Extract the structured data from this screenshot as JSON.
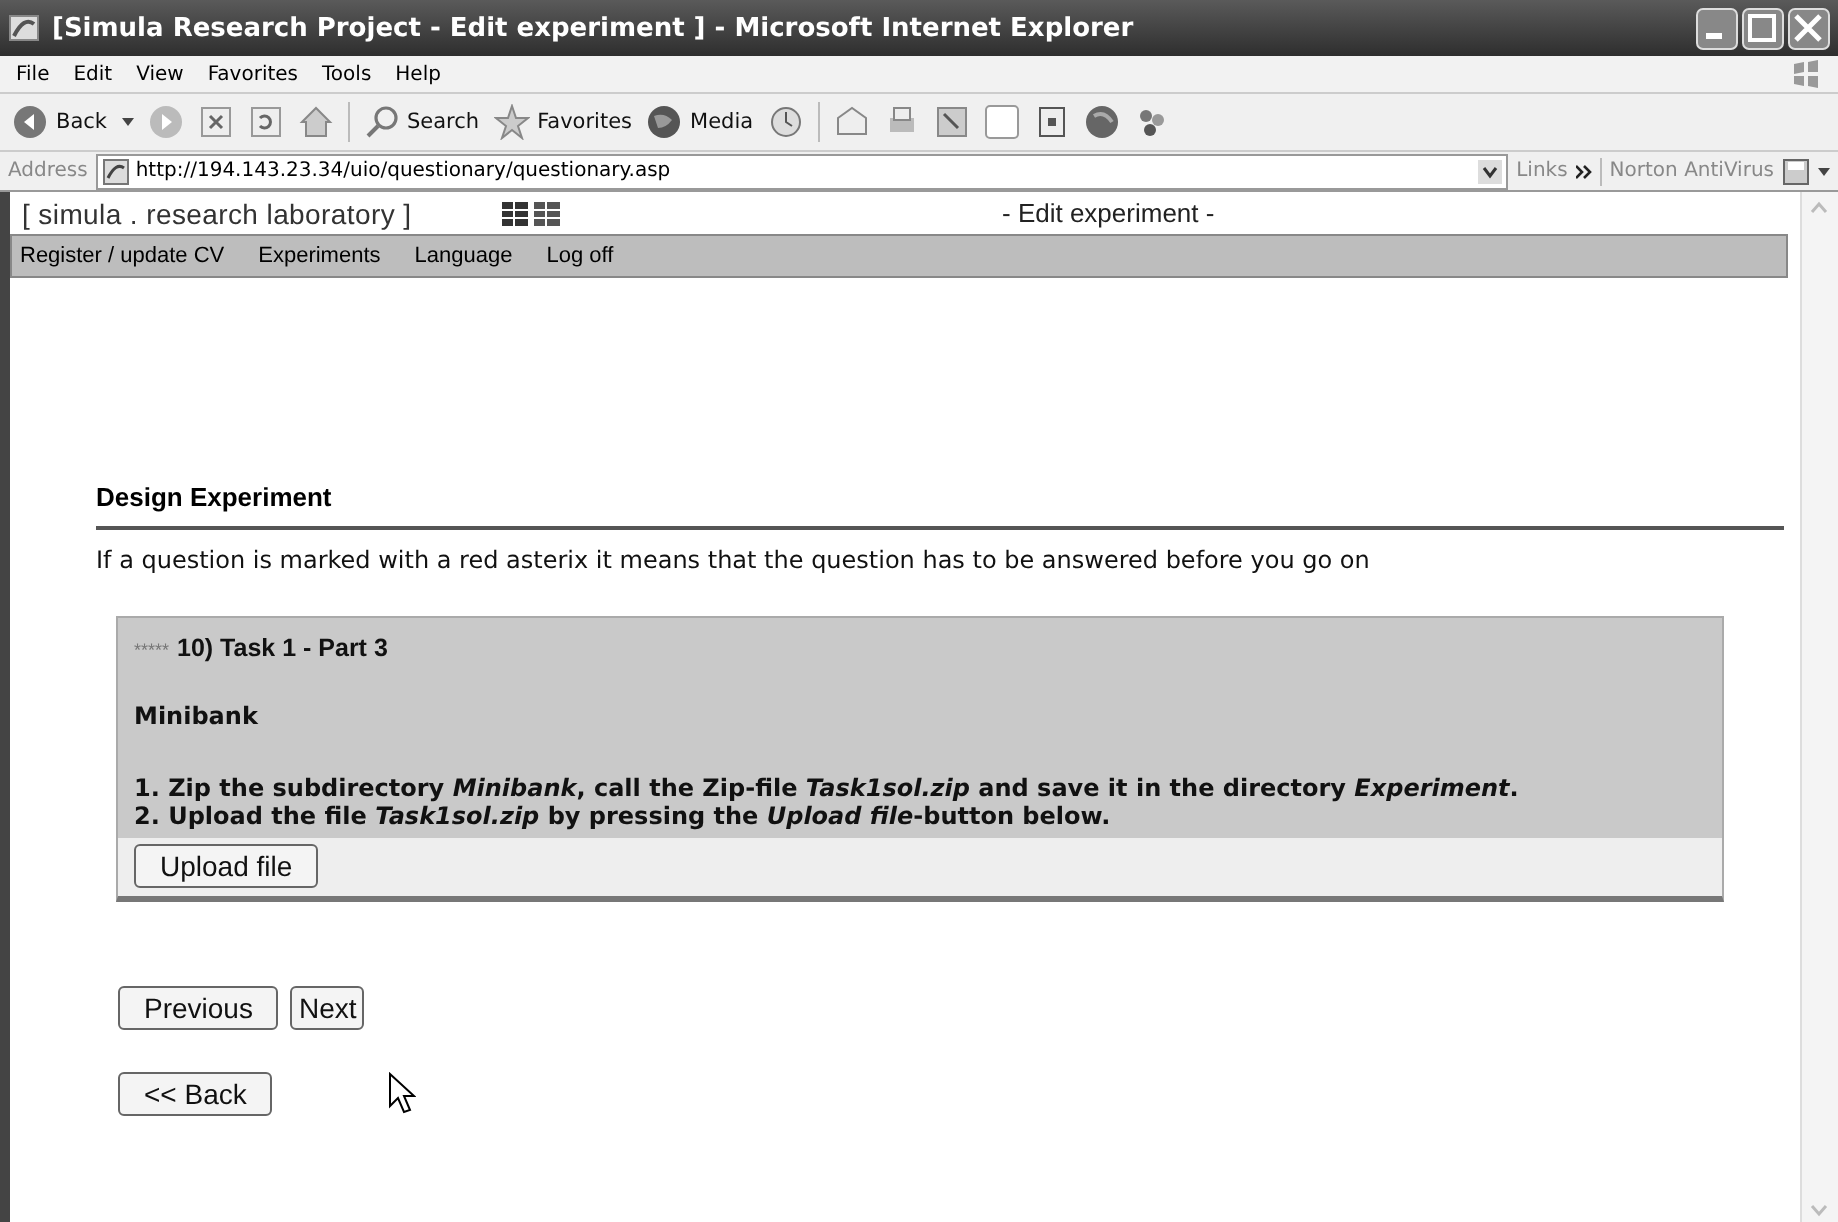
{
  "window": {
    "title": "[Simula Research Project - Edit experiment ] - Microsoft Internet Explorer"
  },
  "menu_bar": [
    "File",
    "Edit",
    "View",
    "Favorites",
    "Tools",
    "Help"
  ],
  "toolbar": [
    {
      "label": "Back",
      "kind": "back"
    },
    {
      "label": "Search",
      "kind": "search"
    },
    {
      "label": "Favorites",
      "kind": "favorites"
    },
    {
      "label": "Media",
      "kind": "media"
    }
  ],
  "address_bar": {
    "label": "Address",
    "value": "http://194.143.23.34/uio/questionary/questionary.asp",
    "links": "Links",
    "extension": "Norton AntiVirus"
  },
  "page": {
    "brand": "[ simula . research laboratory ]",
    "page_title": "- Edit experiment -",
    "nav": [
      "Register / update CV",
      "Experiments",
      "Language",
      "Log off"
    ],
    "heading": "Design Experiment",
    "instruction": "If a question is marked with a red asterix it means that the question has to be answered before you go on",
    "question": {
      "required_mark": "*****",
      "title": "10) Task 1 - Part 3",
      "subtitle": "Minibank",
      "lines": [
        "1. Zip the subdirectory *Minibank*, call the Zip-file *Task1sol.zip* and save it in the directory *Experiment*.",
        "2. Upload the file *Task1sol.zip* by pressing the *Upload file*-button below."
      ],
      "button": "Upload file"
    },
    "nav_buttons": [
      "Previous",
      "Next"
    ],
    "back_button": "<< Back"
  }
}
